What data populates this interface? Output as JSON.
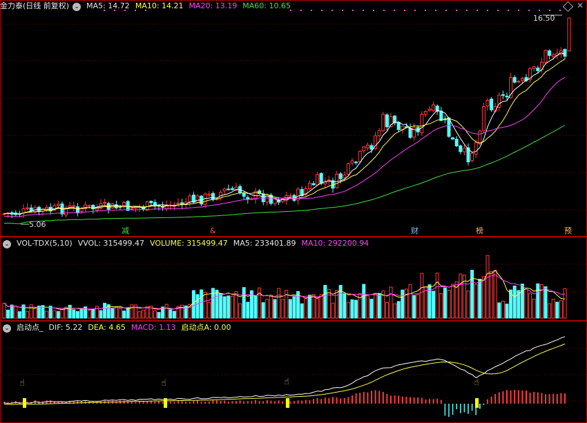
{
  "kline_header": {
    "title": "金力泰(日线 前复权)",
    "ma5": "MA5: 14.72",
    "ma10": "MA10: 14.21",
    "ma20": "MA20: 13.19",
    "ma60": "MA60: 10.65"
  },
  "kline_labels": {
    "high_price": "16.50",
    "low_price": "5.06",
    "events": [
      "减",
      "&",
      "财",
      "榜",
      "预"
    ]
  },
  "volume_header": {
    "name": "VOL-TDX(5,10)",
    "vvol": "VVOL: 315499.47",
    "volume": "VOLUME: 315499.47",
    "ma5": "MA5: 233401.89",
    "ma10": "MA10: 292200.94"
  },
  "macd_header": {
    "name": "启动点_",
    "dif": "DIF: 5.22",
    "dea": "DEA: 4.65",
    "macd": "MACD: 1.13",
    "start": "启动点A: 0.00"
  },
  "colors": {
    "up": "#ff3c3c",
    "down": "#54ffff",
    "ma5": "#ffffff",
    "ma10": "#ffff50",
    "ma20": "#ff40ff",
    "ma60": "#40e040",
    "grid": "#7a0000"
  },
  "icons": [
    "chevron-down-icon",
    "diamond-icon",
    "close-x-icon",
    "hand-pointer-icon"
  ]
}
